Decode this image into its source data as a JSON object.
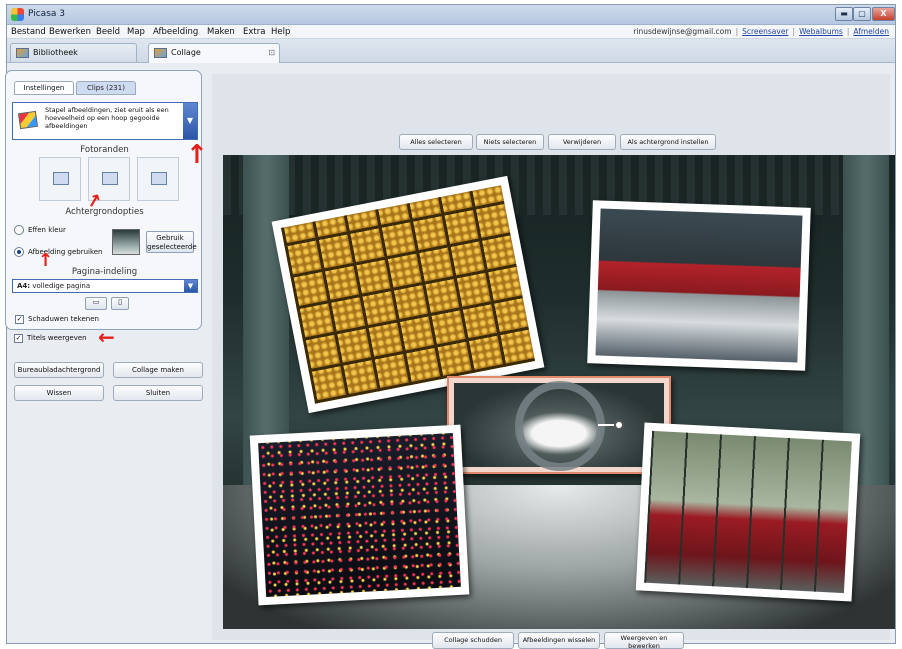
{
  "app": {
    "title": "Picasa 3",
    "window_buttons": {
      "minimize": "▬",
      "maximize": "▢",
      "close": "X"
    }
  },
  "menu": {
    "items": [
      "Bestand",
      "Bewerken",
      "Beeld",
      "Map",
      "Afbeelding",
      "Maken",
      "Extra",
      "Help"
    ],
    "account_email": "rinusdewijnse@gmail.com",
    "links": [
      "Screensaver",
      "Webalbums",
      "Afmelden"
    ]
  },
  "tabs": [
    {
      "label": "Bibliotheek",
      "active": false
    },
    {
      "label": "Collage",
      "active": true
    }
  ],
  "left_panel": {
    "panel_tabs": [
      "Instellingen",
      "Clips (231)"
    ],
    "collage_type": "Stapel afbeeldingen, ziet eruit als een hoeveelheid op een hoop gegooide afbeeldingen",
    "fotoranden_heading": "Fotoranden",
    "achtergrond_heading": "Achtergrondopties",
    "bg_options": [
      {
        "label": "Effen kleur",
        "selected": false
      },
      {
        "label": "Afbeelding gebruiken",
        "selected": true
      }
    ],
    "use_selected_button": "Gebruik geselecteerde",
    "pagina_heading": "Pagina-indeling",
    "layout_prefix": "A4:",
    "layout_value": "volledige pagina",
    "checkboxes": [
      {
        "label": "Schaduwen tekenen",
        "checked": true
      },
      {
        "label": "Titels weergeven",
        "checked": true
      }
    ],
    "actions": [
      "Bureaubladachtergrond",
      "Collage maken",
      "Wissen",
      "Sluiten"
    ]
  },
  "toolbar_top": [
    "Alles selecteren",
    "Niets selecteren",
    "Verwijderen",
    "Als achtergrond instellen"
  ],
  "toolbar_bottom": [
    "Collage schudden",
    "Afbeeldingen wisselen",
    "Weergeven en bewerken"
  ],
  "annotations": {
    "arrow_color": "#e2201a"
  },
  "colors": {
    "accent": "#2b56a8",
    "title_bar": "#b5c8e1"
  }
}
